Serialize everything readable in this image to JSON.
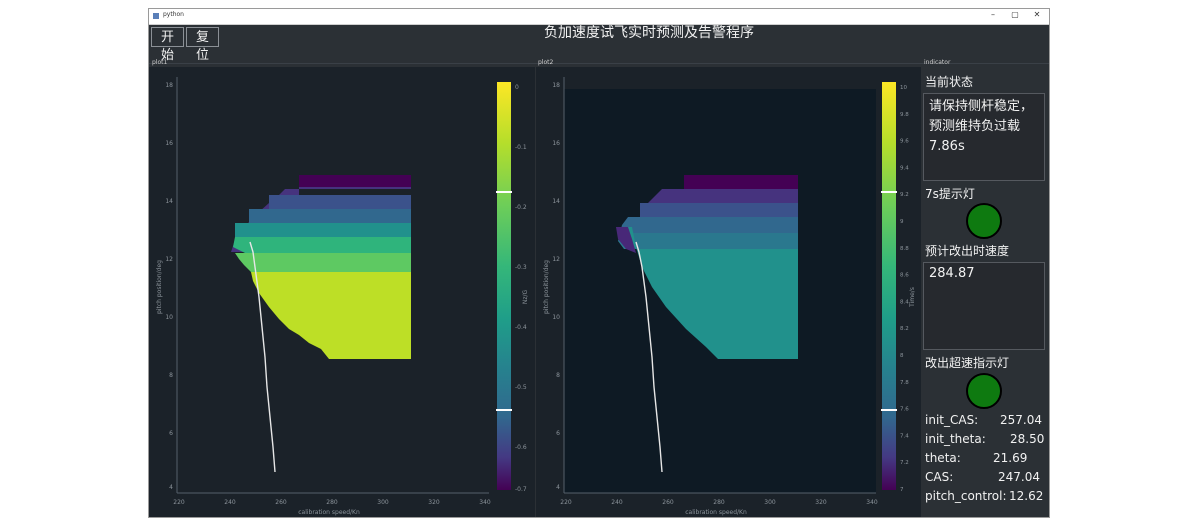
{
  "window": {
    "title": "python",
    "minimize": "–",
    "maximize": "▢",
    "close": "✕"
  },
  "toolbar": {
    "start_label": "开始",
    "reset_label": "复位",
    "app_title": "负加速度试飞实时预测及告警程序"
  },
  "plot1": {
    "panel_label": "plot1",
    "xlabel": "calibration speed/Kn",
    "ylabel": "pitch position/deg",
    "xticks": [
      "220",
      "240",
      "260",
      "280",
      "300",
      "320",
      "340"
    ],
    "yticks": [
      "18",
      "16",
      "14",
      "12",
      "10",
      "8",
      "6",
      "4"
    ],
    "colorbar": {
      "label": "Nz/G",
      "ticks": [
        "0",
        "-0.1",
        "-0.2",
        "-0.3",
        "-0.4",
        "-0.5",
        "-0.6",
        "-0.7"
      ]
    }
  },
  "plot2": {
    "panel_label": "plot2",
    "xlabel": "calibration speed/Kn",
    "ylabel": "pitch position/deg",
    "xticks": [
      "220",
      "240",
      "260",
      "280",
      "300",
      "320",
      "340"
    ],
    "yticks": [
      "18",
      "16",
      "14",
      "12",
      "10",
      "8",
      "6",
      "4"
    ],
    "colorbar": {
      "label": "Time/s",
      "ticks": [
        "10",
        "9.8",
        "9.6",
        "9.4",
        "9.2",
        "9",
        "8.8",
        "8.6",
        "8.4",
        "8.2",
        "8",
        "7.8",
        "7.6",
        "7.4",
        "7.2",
        "7"
      ]
    }
  },
  "indicator": {
    "panel_label": "indicator",
    "status_title": "当前状态",
    "status_text": "请保持侧杆稳定，预测维持负过载7.86s",
    "lamp7s_label": "7s提示灯",
    "lamp7s_color": "#0e7a10",
    "est_speed_title": "预计改出时速度",
    "est_speed_value": "284.87",
    "overspeed_label": "改出超速指示灯",
    "overspeed_color": "#0e7a10",
    "readouts": [
      {
        "key": "init_CAS:",
        "value": "257.04"
      },
      {
        "key": "init_theta:",
        "value": "28.50"
      },
      {
        "key": "theta:",
        "value": "21.69"
      },
      {
        "key": "CAS:",
        "value": "247.04"
      },
      {
        "key": "pitch_control:",
        "value": "12.62"
      }
    ]
  }
}
